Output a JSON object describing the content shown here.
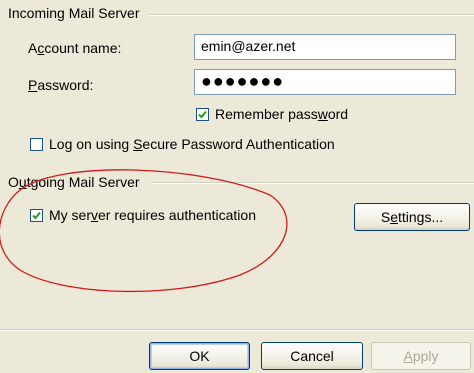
{
  "incoming": {
    "group_title": "Incoming Mail Server",
    "account_label": "Account name:",
    "account_value": "emin@azer.net",
    "password_label": "Password:",
    "password_mask": "●●●●●●●",
    "remember_label": "Remember password",
    "remember_checked": true,
    "spa_label": "Log on using Secure Password Authentication",
    "spa_checked": false
  },
  "outgoing": {
    "group_title": "Outgoing Mail Server",
    "auth_label": "My server requires authentication",
    "auth_checked": true,
    "settings_button": "Settings..."
  },
  "buttons": {
    "ok": "OK",
    "cancel": "Cancel",
    "apply": "Apply"
  },
  "colors": {
    "dialog_bg": "#ece9d8",
    "checkmark": "#21a121",
    "annotation": "#d11a1a",
    "disabled_text": "#aca899"
  }
}
